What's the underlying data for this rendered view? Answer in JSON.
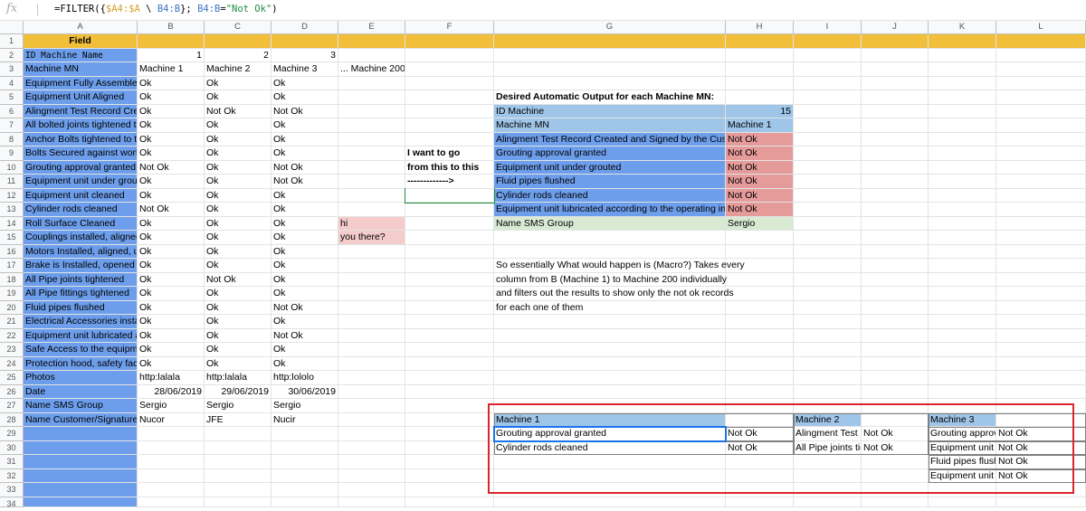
{
  "formula_bar": {
    "fx_label": "fx",
    "formula": {
      "p1": "=FILTER({",
      "r1": "$A4:$A",
      "p2": " \\ ",
      "r2": "B4:B",
      "p3": "}; ",
      "r3": "B4:B",
      "p4": "=",
      "s": "\"Not Ok\"",
      "p5": ")"
    }
  },
  "columns": [
    "A",
    "B",
    "C",
    "D",
    "E",
    "F",
    "G",
    "H",
    "I",
    "J",
    "K",
    "L"
  ],
  "rows": [
    "1",
    "2",
    "3",
    "4",
    "5",
    "6",
    "7",
    "8",
    "9",
    "10",
    "11",
    "12",
    "13",
    "14",
    "15",
    "16",
    "17",
    "18",
    "19",
    "20",
    "21",
    "22",
    "23",
    "24",
    "25",
    "26",
    "27",
    "28",
    "29",
    "30",
    "31",
    "32",
    "33",
    "34"
  ],
  "colors": {
    "header_yellow": "#f2bf3a",
    "field_blue": "#6d9eeb",
    "light_blue": "#9fc5e8",
    "mid_blue": "#6d9eeb",
    "red_cell": "#e69b9b",
    "pink_cell": "#f4cccc",
    "green_cell": "#d9ead3",
    "frame_red": "#d9262c"
  },
  "sheet": {
    "a1": "Field",
    "a2": "ID Machine Name",
    "ids": [
      "1",
      "2",
      "3"
    ],
    "a3": "Machine MN",
    "machines": [
      "Machine 1",
      "Machine 2",
      "Machine 3",
      "... Machine 200"
    ],
    "fields": [
      "Equipment Fully Assembled",
      "Equipment Unit Aligned",
      "Alingment Test Record Created and Signed by the Customer",
      "All bolted joints tightened to",
      "Anchor Bolts tightened to the",
      "Bolts Secured against working",
      "Grouting approval granted",
      "Equipment unit under grouted",
      "Equipment unit cleaned",
      "Cylinder rods cleaned",
      "Roll Surface Cleaned",
      "Couplings installed, aligned,",
      "Motors Installed, aligned, un",
      "Brake is Installed, opened w",
      "All Pipe joints tightened",
      "All Pipe fittings tightened",
      "Fluid pipes flushed",
      "Electrical Accessories install",
      "Equipment unit lubricated ac",
      "Safe Access to the equipme",
      "Protection hood, safety facili",
      "Photos",
      "Date",
      "Name SMS Group",
      "Name Customer/Signature"
    ],
    "col_b": [
      "Ok",
      "Ok",
      "Ok",
      "Ok",
      "Ok",
      "Ok",
      "Not Ok",
      "Ok",
      "Ok",
      "Not Ok",
      "Ok",
      "Ok",
      "Ok",
      "Ok",
      "Ok",
      "Ok",
      "Ok",
      "Ok",
      "Ok",
      "Ok",
      "Ok",
      "http:lalala",
      "28/06/2019",
      "Sergio",
      "Nucor"
    ],
    "col_c": [
      "Ok",
      "Ok",
      "Not Ok",
      "Ok",
      "Ok",
      "Ok",
      "Ok",
      "Ok",
      "Ok",
      "Ok",
      "Ok",
      "Ok",
      "Ok",
      "Ok",
      "Not Ok",
      "Ok",
      "Ok",
      "Ok",
      "Ok",
      "Ok",
      "Ok",
      "http:lalala",
      "29/06/2019",
      "Sergio",
      "JFE"
    ],
    "col_d": [
      "Ok",
      "Ok",
      "Not Ok",
      "Ok",
      "Ok",
      "Ok",
      "Not Ok",
      "Not Ok",
      "Ok",
      "Ok",
      "Ok",
      "Ok",
      "Ok",
      "Ok",
      "Ok",
      "Ok",
      "Not Ok",
      "Ok",
      "Not Ok",
      "Ok",
      "Ok",
      "http:lololo",
      "30/06/2019",
      "Sergio",
      "Nucir"
    ],
    "e14": "hi",
    "e15": "you there?",
    "f9": "I want to go",
    "f10": "from this to this",
    "f11": "------------->",
    "desired": {
      "title": "Desired Automatic Output for each Machine MN:",
      "id_label": "ID Machine",
      "id_value": "15",
      "mn_label": "Machine MN",
      "mn_value": "Machine 1",
      "items": [
        "Alingment Test Record Created and Signed by the Customer",
        "Grouting approval granted",
        "Equipment unit under grouted",
        "Fluid pipes flushed",
        "Cylinder rods cleaned",
        "Equipment unit lubricated according to the operating instructions"
      ],
      "status": "Not Ok",
      "sms_label": "Name SMS Group",
      "sms_value": "Sergio"
    },
    "note": [
      "So essentially What would happen is (Macro?) Takes every",
      "column from B (Machine 1) to Machine 200 individually",
      "and filters out the results to show only the not ok records",
      "for each one of them"
    ],
    "results": {
      "m1_header": "Machine 1",
      "m1_items": [
        "Grouting approval granted",
        "Cylinder rods cleaned"
      ],
      "m2_header": "Machine 2",
      "m2_items": [
        "Alingment Test R",
        "All Pipe joints tig"
      ],
      "m3_header": "Machine 3",
      "m3_items": [
        "Grouting approva",
        "Equipment unit u",
        "Fluid pipes flushe",
        "Equipment unit lu"
      ],
      "status": "Not Ok"
    }
  }
}
